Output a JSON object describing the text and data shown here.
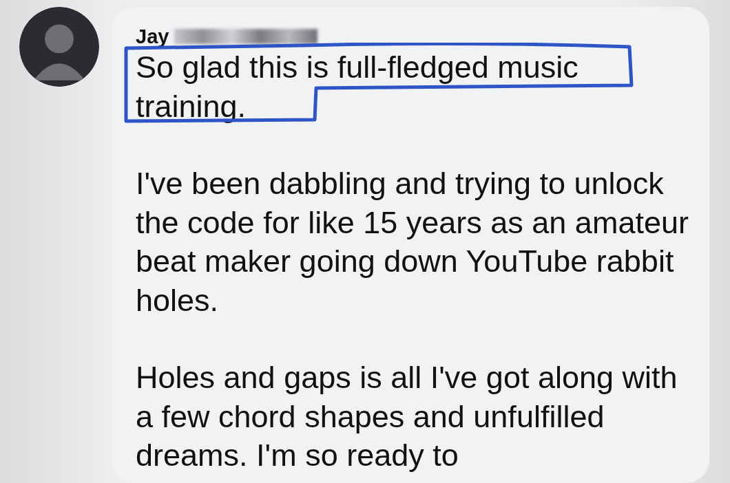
{
  "comment": {
    "author": "Jay",
    "author_redacted": true,
    "paragraphs": [
      {
        "text": "So glad this is full-fledged music training.",
        "highlighted": true
      },
      {
        "text": "I've been dabbling and trying to unlock the code for like 15 years as an amateur beat maker going down YouTube rabbit holes.",
        "highlighted": false
      },
      {
        "text": "Holes and gaps is all I've got along with a few chord shapes and unfulfilled dreams. I'm so ready to",
        "highlighted": false
      }
    ]
  }
}
